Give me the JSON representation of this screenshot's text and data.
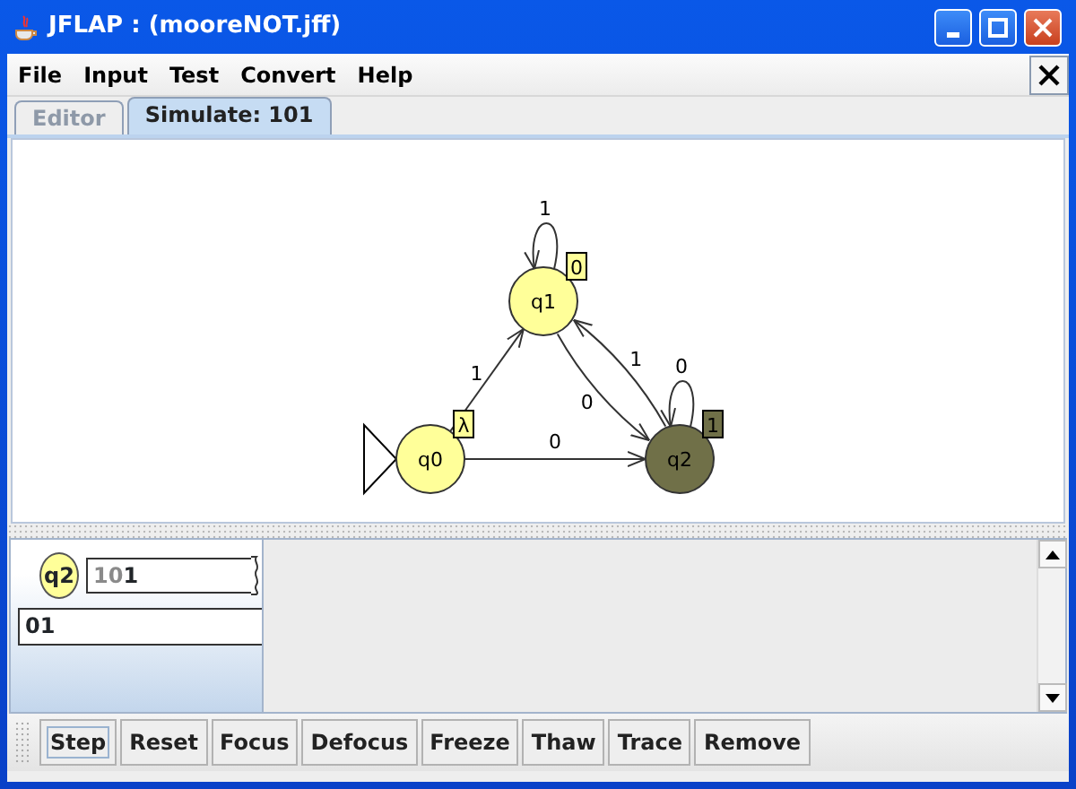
{
  "window": {
    "title": "JFLAP : (mooreNOT.jff)"
  },
  "menu": [
    "File",
    "Input",
    "Test",
    "Convert",
    "Help"
  ],
  "tabs": [
    {
      "label": "Editor",
      "selected": false
    },
    {
      "label": "Simulate: 101",
      "selected": true
    }
  ],
  "automaton": {
    "states": [
      {
        "name": "q0",
        "output": "λ",
        "initial": true,
        "selected": false
      },
      {
        "name": "q1",
        "output": "0",
        "initial": false,
        "selected": false
      },
      {
        "name": "q2",
        "output": "1",
        "initial": false,
        "selected": true
      }
    ],
    "transitions": [
      {
        "label": "1"
      },
      {
        "label": "0"
      },
      {
        "label": "1"
      },
      {
        "label": "0"
      },
      {
        "label": "1"
      },
      {
        "label": "0"
      }
    ]
  },
  "configuration": {
    "state": "q2",
    "input_read": "10",
    "input_remaining": "1",
    "output": "01"
  },
  "buttons": [
    {
      "label": "Step",
      "focused": true
    },
    {
      "label": "Reset",
      "focused": false
    },
    {
      "label": "Focus",
      "focused": false
    },
    {
      "label": "Defocus",
      "focused": false
    },
    {
      "label": "Freeze",
      "focused": false
    },
    {
      "label": "Thaw",
      "focused": false
    },
    {
      "label": "Trace",
      "focused": false
    },
    {
      "label": "Remove",
      "focused": false
    }
  ]
}
